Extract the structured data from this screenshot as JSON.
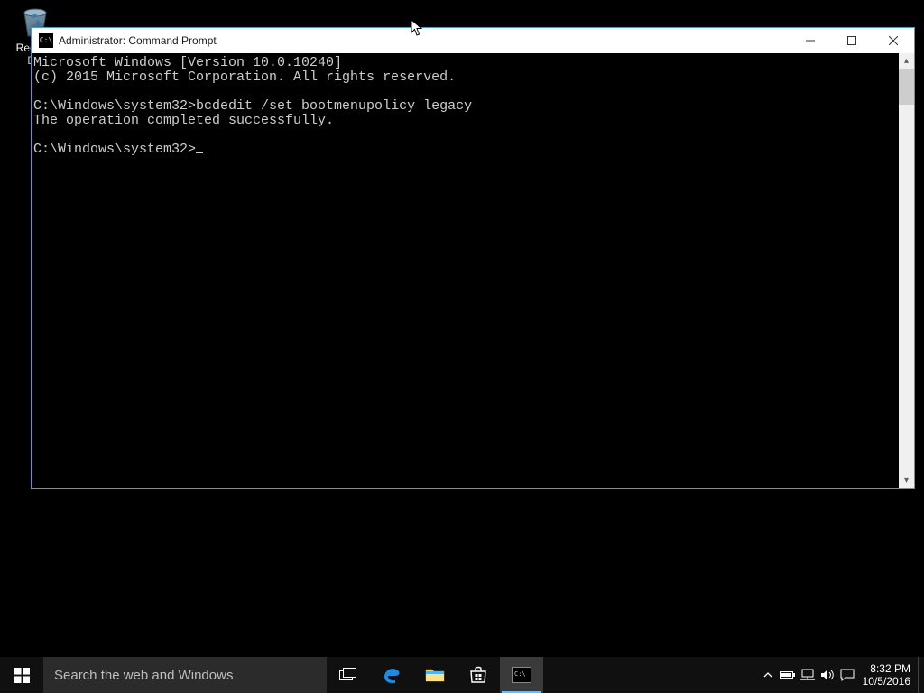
{
  "desktop": {
    "recycle_bin_label": "Recycle Bin"
  },
  "cmd": {
    "title": "Administrator: Command Prompt",
    "lines": {
      "l0": "Microsoft Windows [Version 10.0.10240]",
      "l1": "(c) 2015 Microsoft Corporation. All rights reserved.",
      "l2": "",
      "l3": "C:\\Windows\\system32>bcdedit /set bootmenupolicy legacy",
      "l4": "The operation completed successfully.",
      "l5": "",
      "l6": "C:\\Windows\\system32>"
    }
  },
  "taskbar": {
    "search_placeholder": "Search the web and Windows",
    "clock_time": "8:32 PM",
    "clock_date": "10/5/2016"
  }
}
